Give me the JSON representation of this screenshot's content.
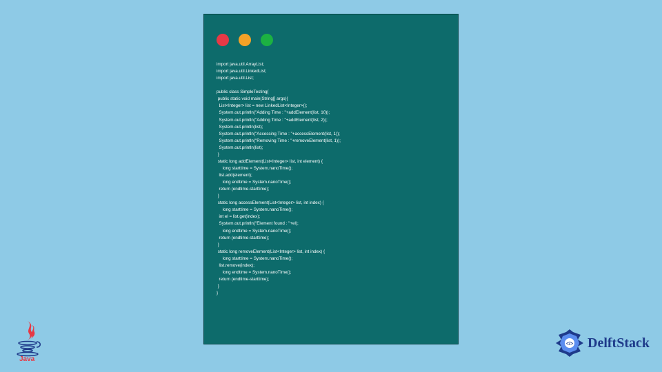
{
  "code_window": {
    "dots": [
      "red",
      "yellow",
      "green"
    ],
    "lines": [
      "import java.util.ArrayList;",
      "import java.util.LinkedList;",
      "import java.util.List;",
      "",
      "public class SimpleTesting{",
      " public static void main(String[] args){",
      "  List<Integer> list = new LinkedList<Integer>();",
      "  System.out.println(\"Adding Time : \"+addElement(list, 10));",
      "  System.out.println(\"Adding Time : \"+addElement(list, 2));",
      "  System.out.println(list);",
      "  System.out.println(\"Accessing Time : \"+accessElement(list, 1));",
      "  System.out.println(\"Removing Time : \"+removeElement(list, 1));",
      "  System.out.println(list);",
      " }",
      " static long addElement(List<Integer> list, int element) {",
      "     long starttime = System.nanoTime();",
      "  list.add(element);",
      "     long endtime = System.nanoTime();",
      "  return (endtime-starttime);",
      " }",
      " static long accessElement(List<Integer> list, int index) {",
      "     long starttime = System.nanoTime();",
      "  int el = list.get(index);",
      "  System.out.println(\"Element found : \"+el);",
      "     long endtime = System.nanoTime();",
      "  return (endtime-starttime);",
      " }",
      " static long removeElement(List<Integer> list, int index) {",
      "     long starttime = System.nanoTime();",
      "  list.remove(index);",
      "     long endtime = System.nanoTime();",
      "  return (endtime-starttime);",
      " }",
      "}"
    ]
  },
  "logos": {
    "java_alt": "Java",
    "delft_text": "DelftStack"
  }
}
